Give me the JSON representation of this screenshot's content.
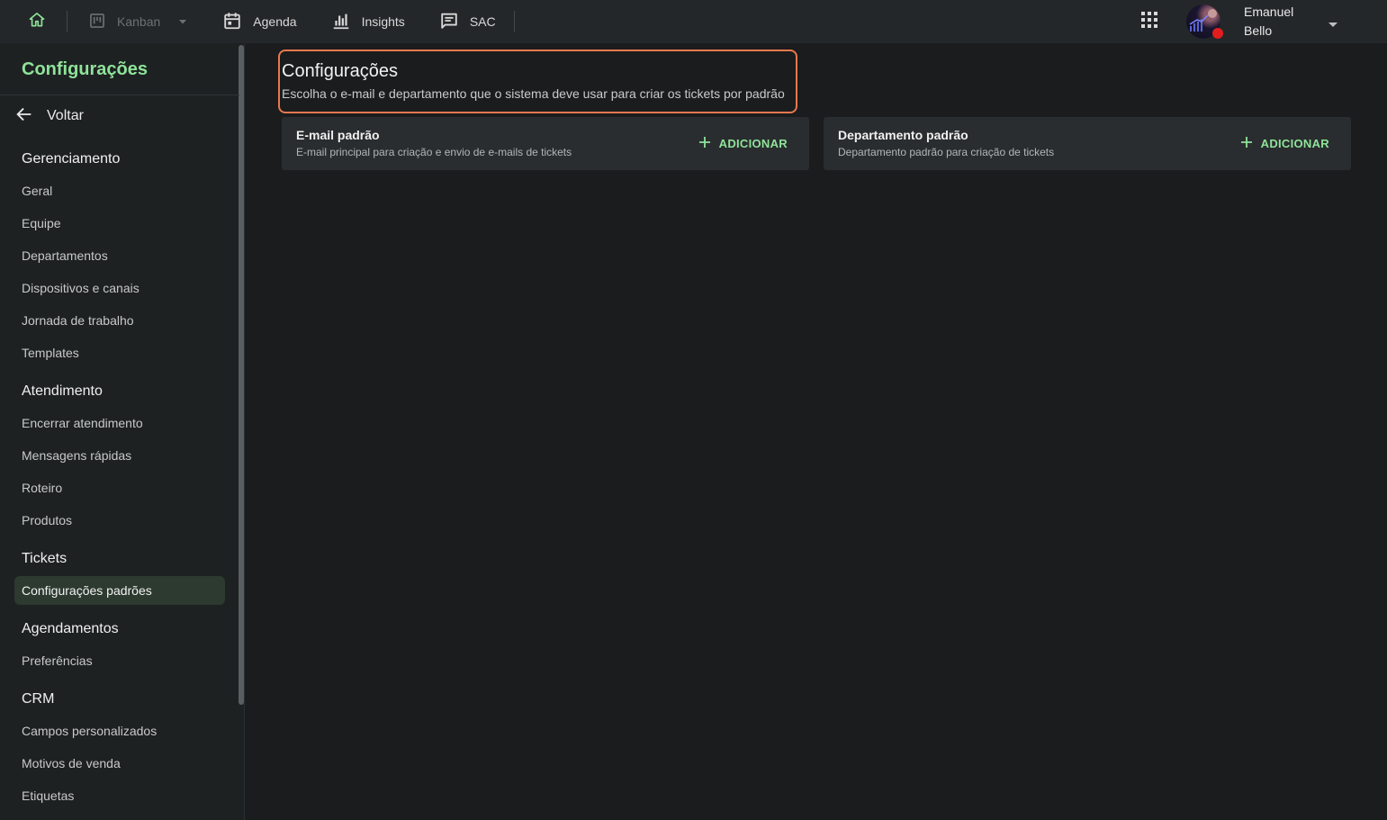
{
  "colors": {
    "accent_green": "#8fe39a",
    "highlight_orange": "#e8784e",
    "status_busy_red": "#e01e1e"
  },
  "topbar": {
    "nav": [
      {
        "label": "Kanban",
        "icon": "kanban-icon",
        "disabled": true
      },
      {
        "label": "Agenda",
        "icon": "calendar-icon"
      },
      {
        "label": "Insights",
        "icon": "bar-chart-icon"
      },
      {
        "label": "SAC",
        "icon": "chat-icon"
      }
    ],
    "user": {
      "first_name": "Emanuel",
      "last_name": "Bello",
      "status": "busy"
    }
  },
  "sidebar": {
    "title": "Configurações",
    "back_label": "Voltar",
    "sections": [
      {
        "title": "Gerenciamento",
        "items": [
          "Geral",
          "Equipe",
          "Departamentos",
          "Dispositivos e canais",
          "Jornada de trabalho",
          "Templates"
        ]
      },
      {
        "title": "Atendimento",
        "items": [
          "Encerrar atendimento",
          "Mensagens rápidas",
          "Roteiro",
          "Produtos"
        ]
      },
      {
        "title": "Tickets",
        "items": [
          "Configurações padrões"
        ]
      },
      {
        "title": "Agendamentos",
        "items": [
          "Preferências"
        ]
      },
      {
        "title": "CRM",
        "items": [
          "Campos personalizados",
          "Motivos de venda",
          "Etiquetas"
        ]
      }
    ],
    "active_item": "Configurações padrões"
  },
  "main": {
    "title": "Configurações",
    "subtitle": "Escolha o e-mail e departamento que o sistema deve usar para criar os tickets por padrão",
    "cards": [
      {
        "title": "E-mail padrão",
        "description": "E-mail principal para criação e envio de e-mails de tickets",
        "action": "ADICIONAR"
      },
      {
        "title": "Departamento padrão",
        "description": "Departamento padrão para criação de tickets",
        "action": "ADICIONAR"
      }
    ]
  }
}
